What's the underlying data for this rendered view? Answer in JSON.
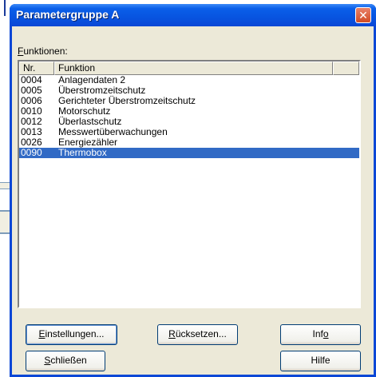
{
  "dialog": {
    "title": "Parametergruppe A",
    "close_glyph": "✕",
    "group_label_accel": "F",
    "group_label_rest": "unktionen:"
  },
  "list": {
    "headers": [
      "Nr.",
      "Funktion"
    ],
    "rows": [
      {
        "nr": "0004",
        "funktion": "Anlagendaten 2"
      },
      {
        "nr": "0005",
        "funktion": "Überstromzeitschutz"
      },
      {
        "nr": "0006",
        "funktion": "Gerichteter Überstromzeitschutz"
      },
      {
        "nr": "0010",
        "funktion": "Motorschutz"
      },
      {
        "nr": "0012",
        "funktion": "Überlastschutz"
      },
      {
        "nr": "0013",
        "funktion": "Messwertüberwachungen"
      },
      {
        "nr": "0026",
        "funktion": "Energiezähler"
      },
      {
        "nr": "0090",
        "funktion": "Thermobox"
      }
    ],
    "selected_index": 7
  },
  "buttons": {
    "settings": {
      "accel": "E",
      "rest": "instellungen..."
    },
    "reset": {
      "accel": "R",
      "rest": "ücksetzen..."
    },
    "info": {
      "pre": "Inf",
      "accel": "o"
    },
    "close": {
      "accel": "S",
      "rest": "chließen"
    },
    "help": {
      "label": "Hilfe"
    }
  },
  "colors": {
    "title_bar": "#0a47d6",
    "selection": "#316ac5",
    "dialog_face": "#ece9d8"
  }
}
